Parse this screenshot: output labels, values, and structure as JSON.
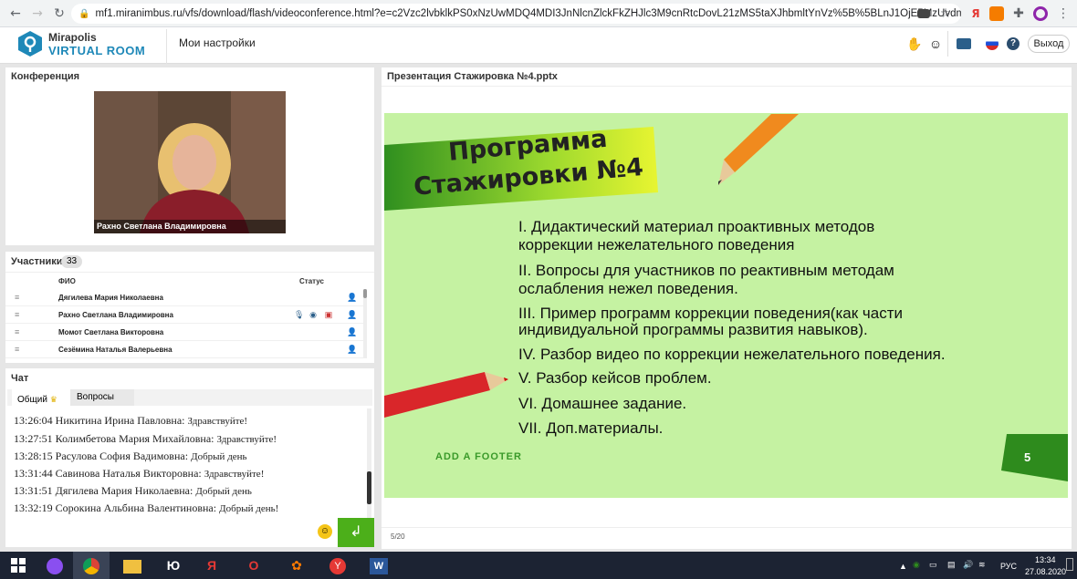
{
  "browser": {
    "url": "mf1.miranimbus.ru/vfs/download/flash/videoconference.html?e=c2Vzc2lvbklkPS0xNzUwMDQ4MDI3JnNlcnZlckFkZHJlc3M9cnRtcDovL21zMS5taXJhbmltYnVz%5B%5BLnJ1OjE5MzUvdml..."
  },
  "app": {
    "logo_line1": "Mirapolis",
    "logo_line2": "VIRTUAL ROOM",
    "settings": "Мои настройки",
    "exit": "Выход"
  },
  "conference": {
    "title": "Конференция",
    "video_name": "Рахно Светлана Владимировна"
  },
  "participants": {
    "title": "Участники",
    "count": "33",
    "col_name": "ФИО",
    "col_status": "Статус",
    "rows": [
      {
        "name": "Дягилева Мария Николаевна"
      },
      {
        "name": "Рахно Светлана Владимировна"
      },
      {
        "name": "Момот Светлана   Викторовна"
      },
      {
        "name": "Сезёмина Наталья  Валерьевна"
      }
    ]
  },
  "chat": {
    "title": "Чат",
    "tab_common": "Общий",
    "tab_questions": "Вопросы",
    "messages": [
      {
        "time": "13:26:04",
        "author": "Никитина Ирина  Павловна:",
        "text": "Здравствуйте!"
      },
      {
        "time": "13:27:51",
        "author": "Колимбетова Мария  Михайловна:",
        "text": "Здравствуйте!"
      },
      {
        "time": "13:28:15",
        "author": "Расулова  София Вадимовна:",
        "text": "Добрый день"
      },
      {
        "time": "13:31:44",
        "author": "Савинова Наталья  Викторовна:",
        "text": "Здравствуйте!"
      },
      {
        "time": "13:31:51",
        "author": "Дягилева Мария Николаевна:",
        "text": "Добрый день"
      },
      {
        "time": "13:32:19",
        "author": "Сорокина Альбина  Валентиновна:",
        "text": "Добрый день!"
      }
    ]
  },
  "presentation": {
    "title": "Презентация Стажировка №4.pptx",
    "slide_title_line1": "Программа",
    "slide_title_line2": "Стажировки №4",
    "items": [
      "I.    Дидактический материал проактивных методов",
      "        коррекции нежелательного поведения",
      "II.   Вопросы для участников по реактивным методам",
      "        ослабления нежел поведения.",
      "III.  Пример программ коррекции поведения(как части",
      "     индивидуальной  программы развития навыков).",
      "IV.  Разбор видео по коррекции нежелательного поведения.",
      "V.   Разбор кейсов проблем.",
      "VI.  Домашнее задание.",
      "VII. Доп.материалы."
    ],
    "footer": "ADD A FOOTER",
    "slide_number": "5",
    "page_info": "5/20"
  },
  "taskbar": {
    "lang": "РУС",
    "time": "13:34",
    "date": "27.08.2020"
  },
  "colors": {
    "brand_blue": "#1e88b8",
    "slide_bg": "#c5f2a2",
    "send_green": "#4caf1a",
    "taskbar": "#1c2333"
  }
}
